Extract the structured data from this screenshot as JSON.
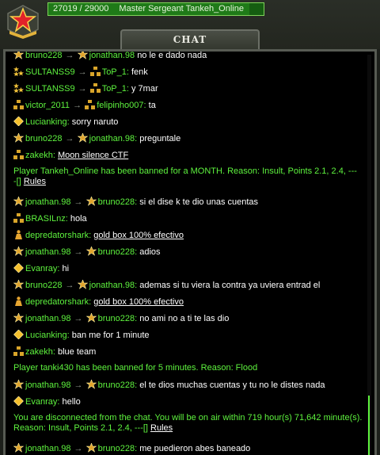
{
  "header": {
    "xp_text": "27019 / 29000",
    "rank_player": "Master Sergeant Tankeh_Online",
    "xp_progress": 0.932
  },
  "chat": {
    "title": "CHAT",
    "messages": [
      {
        "from": "bruno228",
        "from_icon": "stars-rank-icon",
        "to": "jonathan.98",
        "to_icon": "stars-rank-icon",
        "text": "no le e dado nada"
      },
      {
        "from": "SULTANSS9",
        "from_icon": "double-star-rank-icon",
        "to": "ToP_1:",
        "to_icon": "squares-rank-icon",
        "text": "fenk"
      },
      {
        "from": "SULTANSS9",
        "from_icon": "double-star-rank-icon",
        "to": "ToP_1:",
        "to_icon": "squares-rank-icon",
        "text": "y 7mar"
      },
      {
        "from": "victor_2011",
        "from_icon": "squares-rank-icon",
        "to": "felipinho007:",
        "to_icon": "squares-rank-icon",
        "text": "ta"
      },
      {
        "from": "Lucianking:",
        "from_icon": "diamond-rank-icon",
        "text": "sorry naruto"
      },
      {
        "from": "bruno228",
        "from_icon": "stars-rank-icon",
        "to": "jonathan.98:",
        "to_icon": "stars-rank-icon",
        "text": "preguntale"
      },
      {
        "from": "zakekh:",
        "from_icon": "squares-rank-icon",
        "link": "Moon silence CTF"
      },
      {
        "system": "Player Tankeh_Online has been banned for a MONTH. Reason: Insult, Points 2.1, 2.4, ---",
        "system_tail": "-[]",
        "link": "Rules"
      },
      {
        "from": "jonathan.98",
        "from_icon": "stars-rank-icon",
        "to": "bruno228:",
        "to_icon": "stars-rank-icon",
        "text": "si el dise k te dio unas cuentas"
      },
      {
        "from": "BRASILnz:",
        "from_icon": "squares-rank-icon",
        "text": "hola"
      },
      {
        "from": "depredatorshark:",
        "from_icon": "person-rank-icon",
        "link": "gold box 100% efectivo"
      },
      {
        "from": "jonathan.98",
        "from_icon": "stars-rank-icon",
        "to": "bruno228:",
        "to_icon": "stars-rank-icon",
        "text": "adios"
      },
      {
        "from": "Evanray:",
        "from_icon": "diamond-rank-icon",
        "text": "hi"
      },
      {
        "from": "bruno228",
        "from_icon": "stars-rank-icon",
        "to": "jonathan.98:",
        "to_icon": "stars-rank-icon",
        "text": "ademas si tu viera la contra ya uviera entrad el"
      },
      {
        "from": "depredatorshark:",
        "from_icon": "person-rank-icon",
        "link": "gold box 100% efectivo"
      },
      {
        "from": "jonathan.98",
        "from_icon": "stars-rank-icon",
        "to": "bruno228:",
        "to_icon": "stars-rank-icon",
        "text": "no ami no a ti te las dio"
      },
      {
        "from": "Lucianking:",
        "from_icon": "diamond-rank-icon",
        "text": "ban me for 1 minute"
      },
      {
        "from": "zakekh:",
        "from_icon": "squares-rank-icon",
        "text": "blue team"
      },
      {
        "system": "Player tanki430 has been banned for 5 minutes. Reason: Flood"
      },
      {
        "from": "jonathan.98",
        "from_icon": "stars-rank-icon",
        "to": "bruno228:",
        "to_icon": "stars-rank-icon",
        "text": "el te dios muchas cuentas y tu no le distes nada"
      },
      {
        "from": "Evanray:",
        "from_icon": "diamond-rank-icon",
        "text": "hello"
      },
      {
        "system": "You are disconnected from the chat. You will be on air within 719 hour(s) 71,642 minute(s). Reason: Insult, Points 2.1, 2.4, ---[]",
        "link": "Rules"
      },
      {
        "from": "jonathan.98",
        "from_icon": "stars-rank-icon",
        "to": "bruno228:",
        "to_icon": "stars-rank-icon",
        "text": "me puedieron abes baneado"
      }
    ]
  },
  "colors": {
    "nick": "#5ef33e",
    "xp_bar": "#155d11",
    "panel_bg": "#000000"
  }
}
